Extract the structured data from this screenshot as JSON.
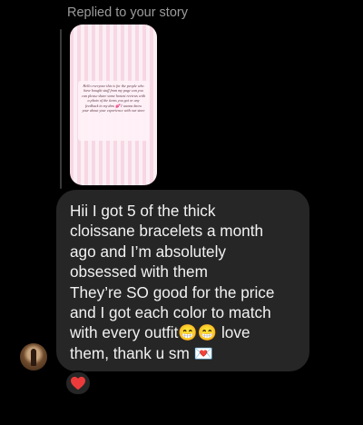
{
  "reply": {
    "header": "Replied to your story",
    "story_text": "Hello everyone this is for the people who have bought stuff from my page can you can please share some honest reviews with a photo of the items you got or any feedback in my dms 💕 I wanna know your about your experience with our store"
  },
  "message": {
    "lines": [
      "Hii I got 5 of the thick",
      "cloissane bracelets a month",
      "ago and I’m absolutely",
      "obsessed with them",
      "They’re SO good for the price",
      "and I got each color to match",
      "with every outfit😁😁 love",
      "them, thank u sm 💌"
    ],
    "reaction": "heart"
  },
  "colors": {
    "background": "#000000",
    "bubble": "#262626",
    "text": "#f2f2f2",
    "muted": "#9b9b9b",
    "heart": "#ed3b3b"
  }
}
